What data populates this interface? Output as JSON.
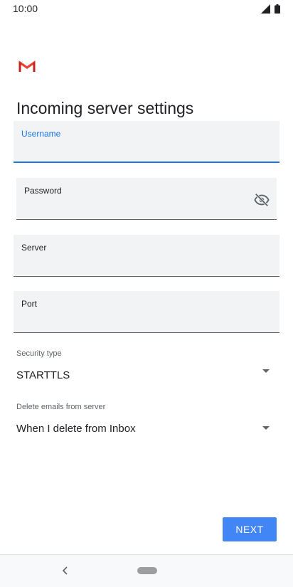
{
  "status_bar": {
    "time": "10:00"
  },
  "page": {
    "title": "Incoming server settings"
  },
  "fields": {
    "username": {
      "label": "Username",
      "value": ""
    },
    "password": {
      "label": "Password",
      "value": ""
    },
    "server": {
      "label": "Server",
      "value": ""
    },
    "port": {
      "label": "Port",
      "value": ""
    }
  },
  "security_type": {
    "label": "Security type",
    "value": "STARTTLS"
  },
  "delete_emails": {
    "label": "Delete emails from server",
    "value": "When I delete from Inbox"
  },
  "actions": {
    "next_label": "NEXT"
  },
  "icons": {
    "logo": "gmail-icon",
    "password_toggle": "visibility-off-icon",
    "dropdown": "dropdown-triangle-icon",
    "nav_back": "back-icon"
  },
  "colors": {
    "accent": "#1a73e8",
    "button": "#4285f4",
    "field_bg": "#f1f3f4"
  }
}
